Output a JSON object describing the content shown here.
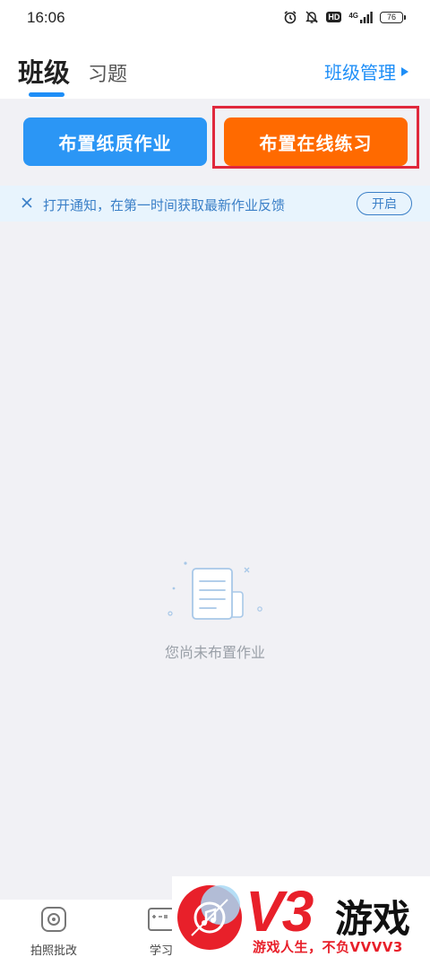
{
  "status_bar": {
    "time": "16:06",
    "network": "4G",
    "hd": "HD",
    "battery": "76"
  },
  "header": {
    "tabs": [
      {
        "label": "班级",
        "active": true
      },
      {
        "label": "习题",
        "active": false
      }
    ],
    "manage_link": "班级管理"
  },
  "actions": {
    "paper_homework": "布置纸质作业",
    "online_practice": "布置在线练习"
  },
  "notice": {
    "text": "打开通知，在第一时间获取最新作业反馈",
    "button": "开启"
  },
  "empty_state": {
    "text": "您尚未布置作业"
  },
  "bottom_nav": [
    {
      "label": "拍照批改",
      "icon": "camera-icon"
    },
    {
      "label": "学习",
      "icon": "math-board-icon"
    }
  ],
  "watermark": {
    "brand": "V3",
    "name": "游戏",
    "slogan": "游戏人生，不负VVVV3"
  },
  "colors": {
    "primary_blue": "#2b96f5",
    "orange": "#ff6a00",
    "highlight_red": "#e0283c"
  }
}
